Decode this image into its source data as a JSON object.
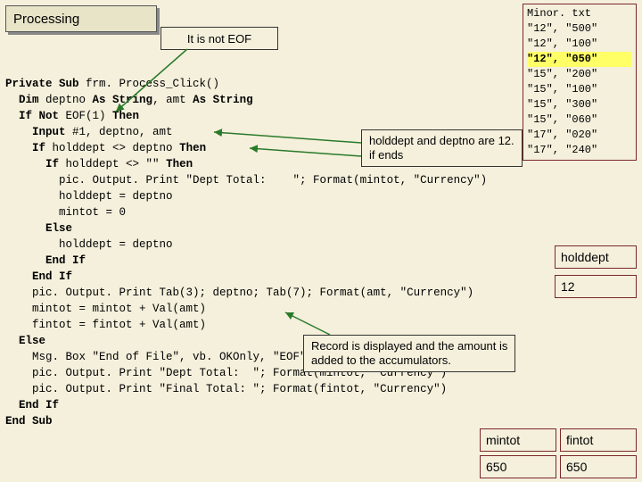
{
  "title": "Processing",
  "eof_label": "It is not EOF",
  "code_lines": [
    "Private Sub frm. Process_Click()",
    "  Dim deptno As String, amt As String",
    "  If Not EOF(1) Then",
    "    Input #1, deptno, amt",
    "    If holddept <> deptno Then",
    "      If holddept <> \"\" Then",
    "        pic. Output. Print \"Dept Total:    \"; Format(mintot, \"Currency\")",
    "        holddept = deptno",
    "        mintot = 0",
    "      Else",
    "        holddept = deptno",
    "      End If",
    "    End If",
    "    pic. Output. Print Tab(3); deptno; Tab(7); Format(amt, \"Currency\")",
    "    mintot = mintot + Val(amt)",
    "    fintot = fintot + Val(amt)",
    "  Else",
    "    Msg. Box \"End of File\", vb. OKOnly, \"EOF\"",
    "    pic. Output. Print \"Dept Total:  \"; Format(mintot, \"Currency\")",
    "    pic. Output. Print \"Final Total: \"; Format(fintot, \"Currency\")",
    "  End If",
    "End Sub"
  ],
  "minor": {
    "title": "Minor. txt",
    "rows": [
      "\"12\", \"500\"",
      "\"12\", \"100\"",
      "\"12\", \"050\"",
      "\"15\", \"200\"",
      "\"15\", \"100\"",
      "\"15\", \"300\"",
      "\"15\", \"060\"",
      "\"17\", \"020\"",
      "\"17\", \"240\""
    ],
    "hl_index": 2
  },
  "holddept": {
    "label": "holddept",
    "value": "12"
  },
  "mintot": {
    "label": "mintot",
    "value": "650"
  },
  "fintot": {
    "label": "fintot",
    "value": "650"
  },
  "anno1_l1": "holddept and deptno are 12.",
  "anno1_l2": "if ends",
  "anno2_l1": "Record is displayed and the amount is",
  "anno2_l2": "added to the accumulators."
}
